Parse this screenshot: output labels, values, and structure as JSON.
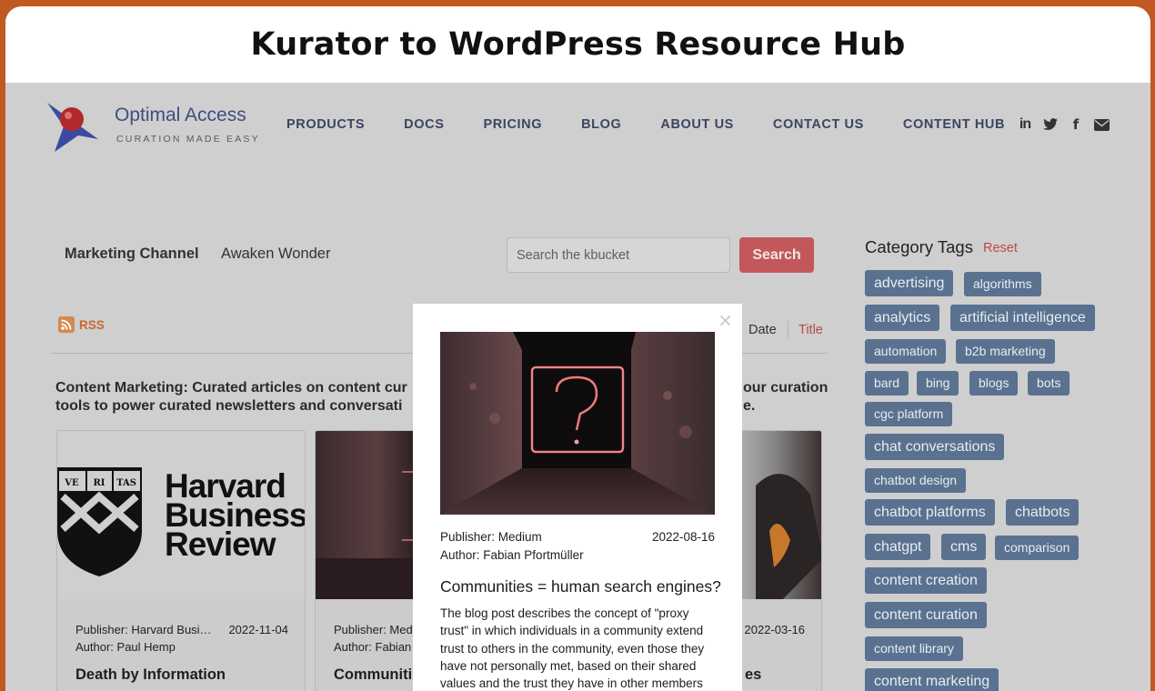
{
  "banner": {
    "title": "Kurator to WordPress Resource Hub"
  },
  "header": {
    "logo_name": "Optimal Access",
    "logo_tagline": "CURATION MADE EASY",
    "nav": [
      "PRODUCTS",
      "DOCS",
      "PRICING",
      "BLOG",
      "ABOUT US",
      "CONTACT US",
      "CONTENT HUB"
    ],
    "social_icons": [
      "linkedin-icon",
      "twitter-icon",
      "facebook-icon",
      "mail-icon"
    ]
  },
  "filters": {
    "channel_label": "Marketing Channel",
    "channel_value": "Awaken Wonder",
    "search_placeholder": "Search the kbucket",
    "search_button": "Search",
    "rss_label": "RSS",
    "sort_date": "Date",
    "sort_title": "Title"
  },
  "description": {
    "left": "Content Marketing: Curated articles on content cur tools to power curated newsletters and conversati",
    "right": "our curation e."
  },
  "cards": [
    {
      "publisher": "Publisher: Harvard Busi…",
      "date": "2022-11-04",
      "author": "Author: Paul Hemp",
      "title": "Death by Information",
      "image_text": [
        "Harvard",
        "Business",
        "Review"
      ],
      "shield_text": [
        "VE",
        "RI",
        "TAS"
      ]
    },
    {
      "publisher": "Publisher: Med",
      "date": "",
      "author": "Author: Fabian",
      "title": "Communiti"
    },
    {
      "publisher": "",
      "date": "2022-03-16",
      "author": "",
      "title": "es"
    }
  ],
  "tags": {
    "title": "Category Tags",
    "reset": "Reset",
    "items": [
      "advertising",
      "algorithms",
      "analytics",
      "artificial intelligence",
      "automation",
      "b2b marketing",
      "bard",
      "bing",
      "blogs",
      "bots",
      "cgc platform",
      "chat conversations",
      "chatbot design",
      "chatbot platforms",
      "chatbots",
      "chatgpt",
      "cms",
      "comparison",
      "content creation",
      "content curation",
      "content library",
      "content marketing"
    ]
  },
  "modal": {
    "close": "×",
    "publisher": "Publisher: Medium",
    "date": "2022-08-16",
    "author": "Author: Fabian Pfortmüller",
    "title": "Communities = human search engines?",
    "body": "The blog post describes the concept of \"proxy trust\" in which individuals in a community extend trust to others in the community, even those they have not personally met, based on their shared values and the trust they have in other members of"
  },
  "colors": {
    "frame": "#c15a22",
    "search_button": "#c3585a",
    "tag_bg": "#5a7290",
    "nav_text": "#3c4460",
    "reset_link": "#c0494b"
  }
}
